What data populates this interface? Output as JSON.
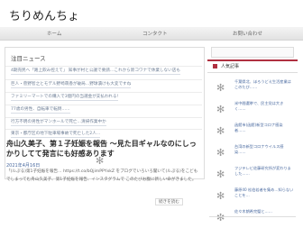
{
  "site": {
    "title": "ちりめんちょ"
  },
  "nav": {
    "items": [
      {
        "label": "ホーム"
      },
      {
        "label": "コンタクト"
      },
      {
        "label": "お問い合わせ"
      }
    ]
  },
  "news": {
    "title": "注目ニュース",
    "items": [
      "4期売民へ「路上飲み控えて」  知事が村と公議で要請…これから新コワナで休業しない店も",
      "巨人・菅野智之とモデル野崎萌香が破局…野球漬けも大変ですね",
      "ファミリーマートでの購入で3億円の当選金が支払われる!",
      "77歳の男性、自転車で転倒……",
      "行方不明の男性がマンホールで死亡…清掃作業中か",
      "東京・都庁区の地下駐車場事故で死亡した2人…"
    ]
  },
  "post": {
    "title": "舟山久美子、第１子妊娠を報告 ～見た目ギャルなのにしっかりしてて発言にも好感あります",
    "date": "2021年4月16日",
    "body": "「(ルぷる)第1子妊娠を報告… https://t.co/bQjimPPYxkZ をブログでいろいろ聞いて(ルぷる)をこどもでしまってむ舟山久美子、第1子妊娠を報告、インスタグラムで このたびお腹に新しい命がきました。",
    "read_more": "続きを読む"
  },
  "sidebar": {
    "heading": "人気記事",
    "items": [
      "千葉県北、ほろうどえ生活産業はこのたび……",
      "米中間選挙で、民主党は大きく……",
      "函館市(函館)新型コロナ感染者……",
      "台湾の新型コロナウイルス感染……",
      "フジテレビ佐藤研究所が変わりました……",
      "藤原40 松伯若者を集め…知らないことを…",
      "佐々木朗希完璧と……"
    ]
  },
  "colors": {
    "accent": "#b03040",
    "link": "#4a6aa0"
  }
}
